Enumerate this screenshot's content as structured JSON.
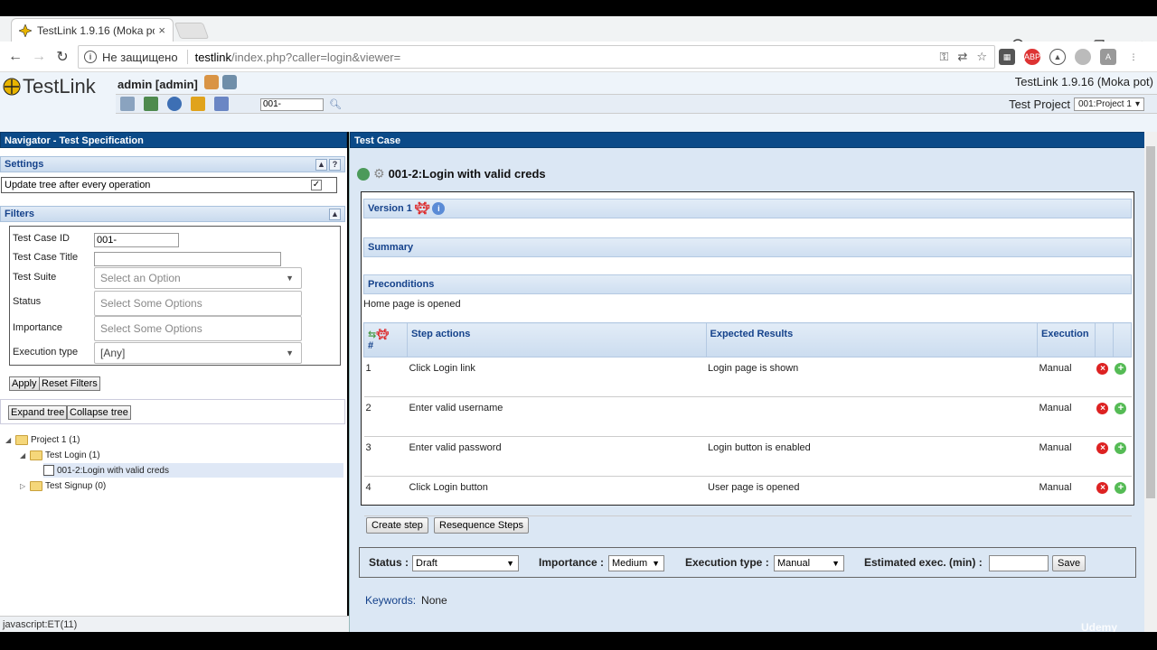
{
  "browser": {
    "tab_title": "TestLink 1.9.16 (Moka po",
    "tab_close": "×",
    "insecure_label": "Не защищено",
    "url_host": "testlink",
    "url_path": "/index.php?caller=login&viewer=",
    "back": "←",
    "forward": "→",
    "reload": "↻",
    "ext_abp": "ABP"
  },
  "header": {
    "logo_text": "TestLink",
    "user": "admin [admin]",
    "tc_search_value": "001-",
    "version": "TestLink 1.9.16 (Moka pot)",
    "project_label": "Test Project",
    "project_value": "001:Project 1"
  },
  "navigator": {
    "title": "Navigator - Test Specification",
    "settings_title": "Settings",
    "update_tree_label": "Update tree after every operation",
    "filters_title": "Filters",
    "filters": {
      "tc_id_label": "Test Case ID",
      "tc_id_value": "001-",
      "tc_title_label": "Test Case Title",
      "suite_label": "Test Suite",
      "suite_placeholder": "Select an Option",
      "status_label": "Status",
      "status_placeholder": "Select Some Options",
      "importance_label": "Importance",
      "importance_placeholder": "Select Some Options",
      "exec_type_label": "Execution type",
      "exec_type_value": "[Any]"
    },
    "apply": "Apply",
    "reset": "Reset Filters",
    "expand": "Expand tree",
    "collapse": "Collapse tree",
    "tree": {
      "project": "Project 1 (1)",
      "suite1": "Test Login (1)",
      "case1": "001-2:Login with valid creds",
      "suite2": "Test Signup (0)"
    }
  },
  "status_bar": "javascript:ET(11)",
  "testcase": {
    "panel_title": "Test Case",
    "title": "001-2:Login with valid creds",
    "version": "Version 1",
    "summary": "Summary",
    "preconditions": "Preconditions",
    "preconditions_text": "Home page is opened",
    "columns": {
      "num": "#",
      "actions": "Step actions",
      "expected": "Expected Results",
      "execution": "Execution"
    },
    "steps": [
      {
        "n": "1",
        "action": "Click Login link",
        "expected": "Login page is shown",
        "exec": "Manual"
      },
      {
        "n": "2",
        "action": "Enter valid username",
        "expected": "",
        "exec": "Manual"
      },
      {
        "n": "3",
        "action": "Enter valid password",
        "expected": "Login button is enabled",
        "exec": "Manual"
      },
      {
        "n": "4",
        "action": "Click Login button",
        "expected": "User page is opened",
        "exec": "Manual"
      }
    ],
    "create_step": "Create step",
    "resequence": "Resequence Steps",
    "status_label": "Status :",
    "status_value": "Draft",
    "importance_label": "Importance :",
    "importance_value": "Medium",
    "exec_type_label": "Execution type :",
    "exec_type_value": "Manual",
    "estimated_label": "Estimated exec. (min) :",
    "save": "Save",
    "keywords_label": "Keywords:",
    "keywords_value": "None"
  },
  "watermark": "Udemy",
  "colors": {
    "panel_blue": "#0b4a88",
    "section_text": "#15428b"
  }
}
